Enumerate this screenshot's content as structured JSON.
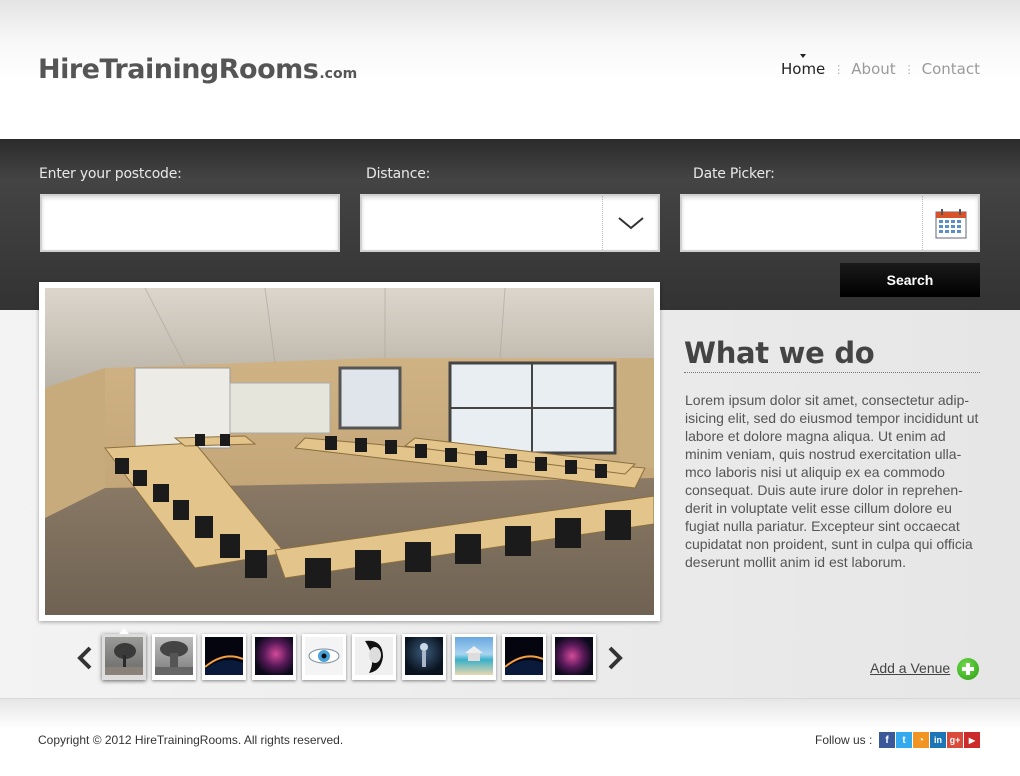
{
  "header": {
    "logo_main": "HireTrainingRooms",
    "logo_suffix": ".com",
    "nav": [
      {
        "label": "Home",
        "active": true
      },
      {
        "label": "About",
        "active": false
      },
      {
        "label": "Contact",
        "active": false
      }
    ],
    "nav_separator": "⋮"
  },
  "search": {
    "postcode_label": "Enter your postcode:",
    "postcode_value": "",
    "distance_label": "Distance:",
    "distance_value": "",
    "date_label": "Date Picker:",
    "date_value": "",
    "button_label": "Search"
  },
  "main": {
    "title": "What we do",
    "body": "Lorem ipsum dolor sit amet, consectetur adip- isicing elit, sed do eiusmod tempor incididunt ut labore et dolore magna aliqua. Ut enim ad minim veniam, quis nostrud exercitation ulla- mco laboris nisi ut aliquip ex ea commodo consequat. Duis aute irure dolor in reprehen- derit in voluptate velit esse cillum dolore eu fugiat nulla pariatur. Excepteur sint occaecat cupidatat non proident, sunt in culpa qui officia deserunt mollit anim id est laborum.",
    "add_venue_label": "Add a Venue"
  },
  "gallery": {
    "thumbnails": [
      {
        "name": "tree-thumbnail",
        "active": true
      },
      {
        "name": "mushroom-cloud-thumbnail",
        "active": false
      },
      {
        "name": "planet-horizon-thumbnail",
        "active": false
      },
      {
        "name": "nebula-thumbnail",
        "active": false
      },
      {
        "name": "eye-thumbnail",
        "active": false
      },
      {
        "name": "portrait-thumbnail",
        "active": false
      },
      {
        "name": "figure-thumbnail",
        "active": false
      },
      {
        "name": "beach-hut-thumbnail",
        "active": false
      },
      {
        "name": "planet-horizon-thumbnail-2",
        "active": false
      },
      {
        "name": "nebula-thumbnail-2",
        "active": false
      }
    ]
  },
  "footer": {
    "copyright": "Copyright © 2012 HireTrainingRooms. All rights reserved.",
    "follow_label": "Follow us :",
    "social": [
      {
        "name": "facebook-icon",
        "glyph": "f",
        "color": "#3b5998"
      },
      {
        "name": "twitter-icon",
        "glyph": "t",
        "color": "#33aaee"
      },
      {
        "name": "rss-icon",
        "glyph": "◔",
        "color": "#f29422"
      },
      {
        "name": "linkedin-icon",
        "glyph": "in",
        "color": "#1c75b5"
      },
      {
        "name": "googleplus-icon",
        "glyph": "g+",
        "color": "#d94a3a"
      },
      {
        "name": "youtube-icon",
        "glyph": "▶",
        "color": "#cc2b2b"
      }
    ]
  },
  "colors": {
    "band": "#3a3a3a",
    "search_button": "#0d0d0d",
    "add_icon": "#3cb521"
  }
}
